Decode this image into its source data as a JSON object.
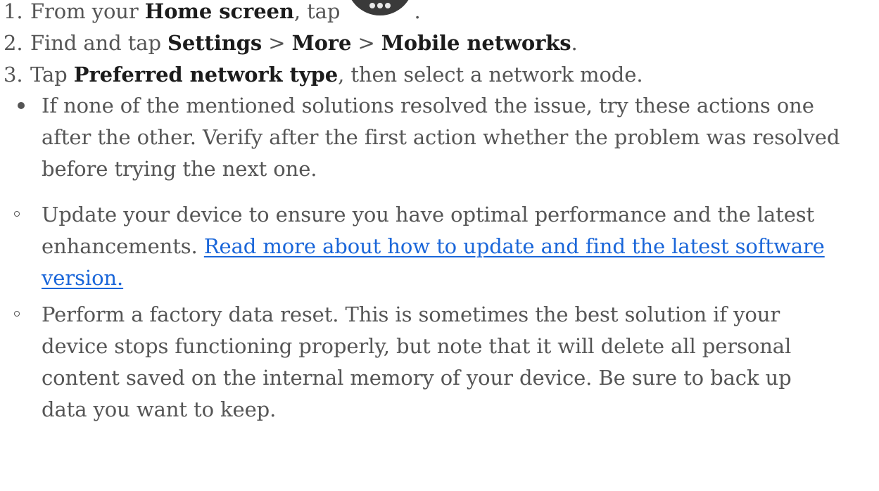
{
  "steps": [
    {
      "number": "1.",
      "parts": {
        "a": "From your ",
        "b": "Home screen",
        "c": ", tap ",
        "d": "."
      },
      "icon": "apps-icon"
    },
    {
      "number": "2.",
      "parts": {
        "a": "Find and tap ",
        "b": "Settings",
        "c": " > ",
        "d": "More",
        "e": " > ",
        "f": "Mobile networks",
        "g": "."
      }
    },
    {
      "number": "3.",
      "parts": {
        "a": "Tap ",
        "b": "Preferred network type",
        "c": ", then select a network mode."
      }
    }
  ],
  "tip": {
    "lines": [
      "If none of the mentioned solutions resolved the issue, try these actions one",
      "after the other. Verify after the first action whether the problem was resolved",
      "before trying the next one."
    ]
  },
  "actions": [
    {
      "lines": [
        "Update your device to ensure you have optimal performance and the latest",
        "enhancements. "
      ],
      "link_lines": [
        "Read more about how to update and find the latest software",
        "version."
      ]
    },
    {
      "lines": [
        "Perform a factory data reset. This is sometimes the best solution if your",
        "device stops functioning properly, but note that it will delete all personal",
        "content saved on the internal memory of your device. Be sure to back up",
        "data you want to keep."
      ]
    }
  ],
  "colors": {
    "text": "#555555",
    "bold": "#1c1c1c",
    "link": "#1a66d9",
    "icon": "#3a3a3a"
  }
}
